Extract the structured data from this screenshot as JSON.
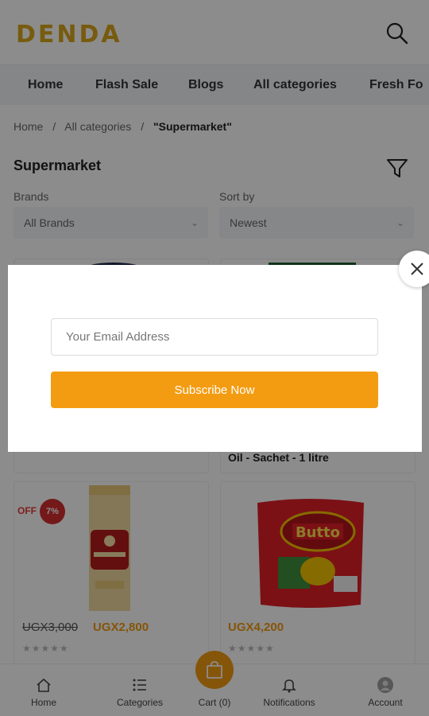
{
  "header": {
    "logo_text": "DENDA",
    "search_icon": "search-icon"
  },
  "nav": {
    "items": [
      "Home",
      "Flash Sale",
      "Blogs",
      "All categories",
      "Fresh Fo"
    ]
  },
  "breadcrumb": {
    "home": "Home",
    "sep": "/",
    "categories": "All categories",
    "current": "\"Supermarket\""
  },
  "page": {
    "title": "Supermarket",
    "filter_icon": "filter-icon"
  },
  "filters": {
    "brands_label": "Brands",
    "brands_value": "All Brands",
    "sort_label": "Sort by",
    "sort_value": "Newest"
  },
  "products": [
    {
      "title": "Oil - Sachet - 1 litre"
    },
    {
      "old_price": "UGX3,000",
      "price": "UGX2,800",
      "off_label": "OFF",
      "discount": "7%",
      "stars": "★★★★★"
    },
    {
      "price": "UGX4,200",
      "stars": "★★★★★"
    }
  ],
  "bottom_nav": {
    "home": "Home",
    "categories": "Categories",
    "cart": "Cart (0)",
    "notifications": "Notifications",
    "account": "Account"
  },
  "modal": {
    "email_placeholder": "Your Email Address",
    "subscribe_label": "Subscribe Now",
    "close_icon": "close-icon"
  },
  "colors": {
    "accent": "#f39c12",
    "logo": "#d9a71a",
    "discount": "#d32f2f"
  }
}
